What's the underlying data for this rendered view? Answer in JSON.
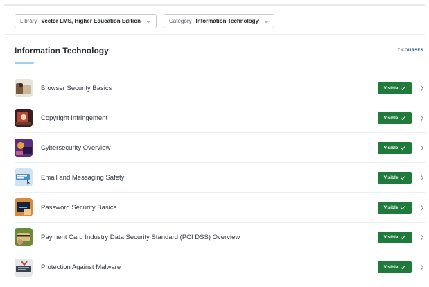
{
  "filters": {
    "library": {
      "label": "Library",
      "value": "Vector LMS, Higher Education Edition"
    },
    "category": {
      "label": "Category",
      "value": "Information Technology"
    }
  },
  "section": {
    "title": "Information Technology",
    "count": "7 COURSES"
  },
  "courses": [
    {
      "title": "Browser Security Basics",
      "status": "Visible",
      "thumb": "browser-security-thumbnail"
    },
    {
      "title": "Copyright Infringement",
      "status": "Visible",
      "thumb": "copyright-thumbnail"
    },
    {
      "title": "Cybersecurity Overview",
      "status": "Visible",
      "thumb": "cybersecurity-thumbnail"
    },
    {
      "title": "Email and Messaging Safety",
      "status": "Visible",
      "thumb": "email-thumbnail"
    },
    {
      "title": "Password Security Basics",
      "status": "Visible",
      "thumb": "password-thumbnail"
    },
    {
      "title": "Payment Card Industry Data Security Standard (PCI DSS) Overview",
      "status": "Visible",
      "thumb": "pci-thumbnail"
    },
    {
      "title": "Protection Against Malware",
      "status": "Visible",
      "thumb": "malware-thumbnail"
    }
  ],
  "colors": {
    "visible_badge": "#1f7a3c",
    "accent_underline": "#9fd0ea",
    "count_text": "#1f4f86"
  }
}
